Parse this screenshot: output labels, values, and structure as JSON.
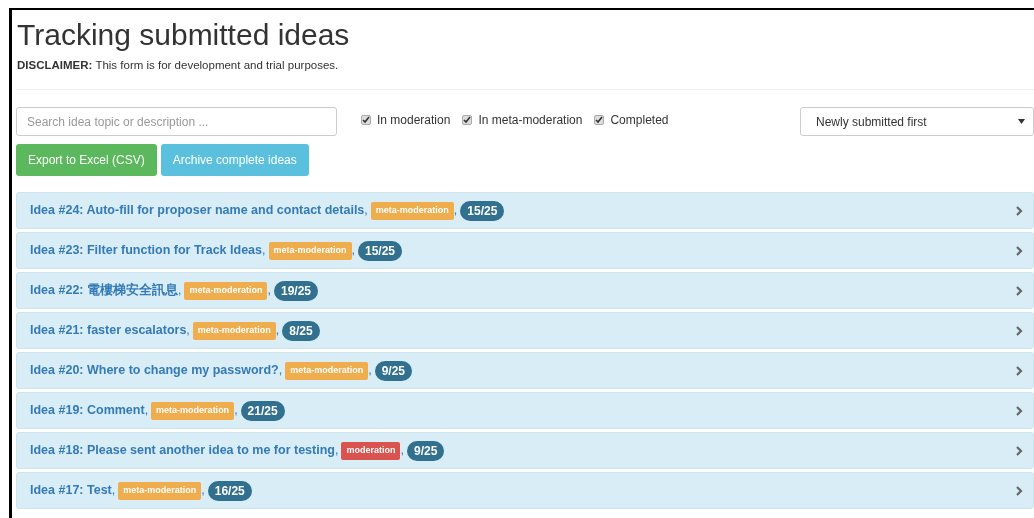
{
  "title": "Tracking submitted ideas",
  "disclaimer": "**DISCLAIMER:** This form is for development and trial purposes.",
  "search": {
    "placeholder": "Search idea topic or description ..."
  },
  "filters": [
    {
      "label": "In moderation",
      "checked": true
    },
    {
      "label": "In meta-moderation",
      "checked": true
    },
    {
      "label": "Completed",
      "checked": true
    }
  ],
  "sort": {
    "value": "Newly submitted first"
  },
  "buttons": [
    {
      "label": "Export to Excel (CSV)",
      "kind": "success"
    },
    {
      "label": "Archive complete ideas",
      "kind": "info"
    }
  ],
  "separator": ",",
  "ideas": [
    {
      "title": "Idea #24: Auto-fill for proposer name and contact details",
      "status": "meta-moderation",
      "color": "#f0ad4e",
      "score": "15/25"
    },
    {
      "title": "Idea #23: Filter function for Track Ideas",
      "status": "meta-moderation",
      "color": "#f0ad4e",
      "score": "15/25"
    },
    {
      "title": "Idea #22: 電樓梯安全訊息",
      "status": "meta-moderation",
      "color": "#f0ad4e",
      "score": "19/25"
    },
    {
      "title": "Idea #21: faster escalators",
      "status": "meta-moderation",
      "color": "#f0ad4e",
      "score": "8/25"
    },
    {
      "title": "Idea #20: Where to change my password?",
      "status": "meta-moderation",
      "color": "#f0ad4e",
      "score": "9/25"
    },
    {
      "title": "Idea #19: Comment",
      "status": "meta-moderation",
      "color": "#f0ad4e",
      "score": "21/25"
    },
    {
      "title": "Idea #18: Please sent another idea to me for testing",
      "status": "moderation",
      "color": "#d9534f",
      "score": "9/25"
    },
    {
      "title": "Idea #17: Test",
      "status": "meta-moderation",
      "color": "#f0ad4e",
      "score": "16/25"
    }
  ]
}
